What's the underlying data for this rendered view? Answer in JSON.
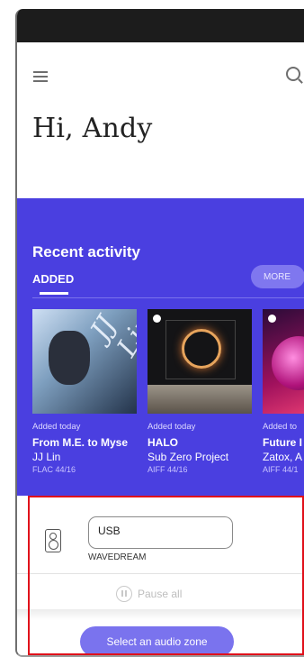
{
  "header": {
    "greeting": "Hi, Andy"
  },
  "activity": {
    "title": "Recent activity",
    "tab_added": "ADDED",
    "more_label": "MORE",
    "albums": [
      {
        "added": "Added today",
        "title": "From M.E. to Myse",
        "artist": "JJ Lin",
        "format": "FLAC 44/16"
      },
      {
        "added": "Added today",
        "title": "HALO",
        "artist": "Sub Zero Project",
        "format": "AIFF 44/16"
      },
      {
        "added": "Added to",
        "title": "Future I",
        "artist": "Zatox, A",
        "format": "AIFF 44/1"
      }
    ]
  },
  "zone": {
    "device_value": "USB",
    "device_sub": "WAVEDREAM",
    "pause_label": "Pause all",
    "select_label": "Select an audio zone"
  },
  "colors": {
    "accent": "#4a3fe0",
    "button": "#7a73ee",
    "highlight": "#e0101a"
  }
}
